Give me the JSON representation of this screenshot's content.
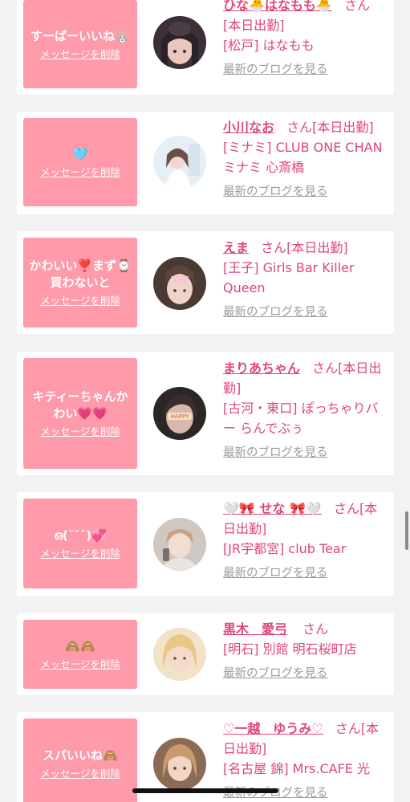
{
  "messages": [
    {
      "message": "すーぱーいいね🐰",
      "delete_label": "メッセージを削除",
      "name": "ひな🐣はなもも🐣",
      "honorific": "さん",
      "status": "[本日出勤]",
      "shop": "[松戸] はなもも",
      "blog_label": "最新のブログを見る"
    },
    {
      "message": "🩵",
      "delete_label": "メッセージを削除",
      "name": "小川なお",
      "honorific": "さん",
      "status": "[本日出勤]",
      "shop": "[ミナミ] CLUB ONE CHAN ミナミ 心斎橋",
      "blog_label": "最新のブログを見る"
    },
    {
      "message": "かわいい❣️まず⌚️買わないと",
      "delete_label": "メッセージを削除",
      "name": "えま",
      "honorific": "さん",
      "status": "[本日出勤]",
      "shop": "[王子] Girls Bar Killer Queen",
      "blog_label": "最新のブログを見る"
    },
    {
      "message": "キティーちゃんかわい💗💗",
      "delete_label": "メッセージを削除",
      "name": "まりあちゃん",
      "honorific": "さん",
      "status": "[本日出勤]",
      "shop": "[古河・東口] ぽっちゃりバー らんでぶぅ",
      "blog_label": "最新のブログを見る"
    },
    {
      "message": "ഒ(˘˘ˆ)💞",
      "delete_label": "メッセージを削除",
      "name": "🤍🎀 せな 🎀🤍",
      "honorific": "さん",
      "status": "[本日出勤]",
      "shop": "[JR宇都宮] club Tear",
      "blog_label": "最新のブログを見る"
    },
    {
      "message": "🙈🙈",
      "delete_label": "メッセージを削除",
      "name": "黒木　愛弓",
      "honorific": "さん",
      "status": "",
      "shop": "[明石] 別館 明石桜町店",
      "blog_label": "最新のブログを見る"
    },
    {
      "message": "スパいいね🙈",
      "delete_label": "メッセージを削除",
      "name": "♡一越　ゆうみ♡",
      "honorific": "さん",
      "status": "[本日出勤]",
      "shop": "[名古屋 錦] Mrs.CAFE 光",
      "blog_label": "最新のブログを見る"
    }
  ],
  "colors": {
    "card_pink": "#ff9aaa",
    "name_pink": "#e0457b",
    "link_gray": "#9b9b9b",
    "background": "#f2f2f2"
  }
}
